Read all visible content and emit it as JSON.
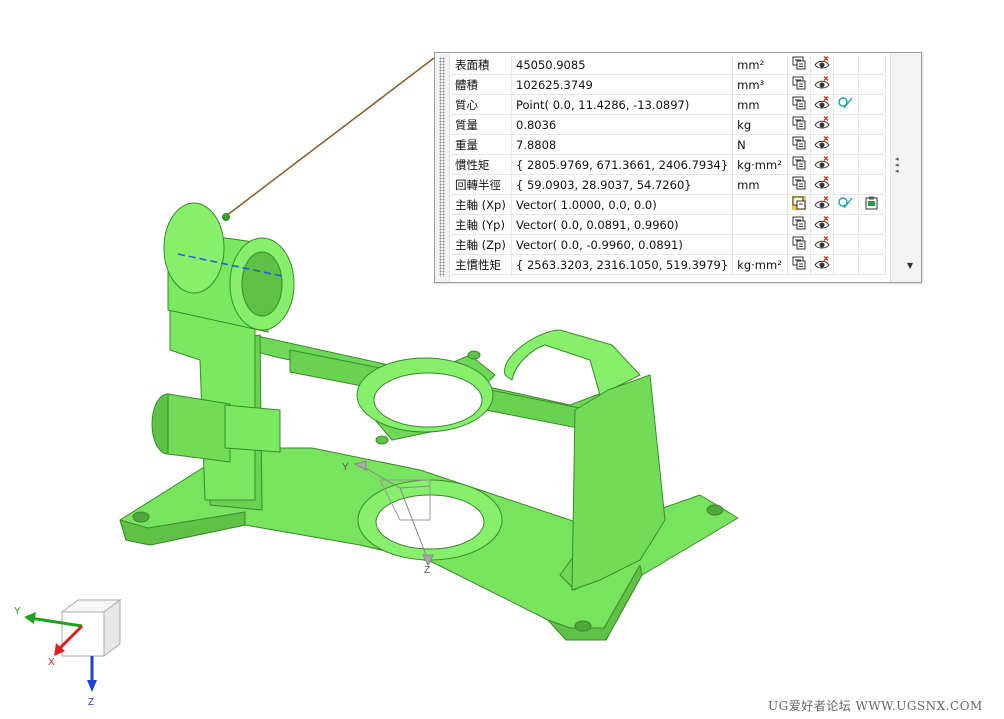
{
  "properties": [
    {
      "name": "表面積",
      "value": "45050.9085",
      "unit": "mm²",
      "extra": false,
      "special": false
    },
    {
      "name": "體積",
      "value": "102625.3749",
      "unit": "mm³",
      "extra": false,
      "special": false
    },
    {
      "name": "質心",
      "value": "Point( 0.0, 11.4286, -13.0897)",
      "unit": "mm",
      "extra": true,
      "special": false
    },
    {
      "name": "質量",
      "value": "0.8036",
      "unit": "kg",
      "extra": false,
      "special": false
    },
    {
      "name": "重量",
      "value": "7.8808",
      "unit": "N",
      "extra": false,
      "special": false
    },
    {
      "name": "慣性矩",
      "value": "{ 2805.9769, 671.3661, 2406.7934}",
      "unit": "kg·mm²",
      "extra": false,
      "special": false
    },
    {
      "name": "回轉半徑",
      "value": "{ 59.0903, 28.9037, 54.7260}",
      "unit": "mm",
      "extra": false,
      "special": false
    },
    {
      "name": "主軸 (Xp)",
      "value": "Vector( 1.0000, 0.0, 0.0)",
      "unit": "",
      "extra": true,
      "special": true
    },
    {
      "name": "主軸 (Yp)",
      "value": "Vector( 0.0, 0.0891, 0.9960)",
      "unit": "",
      "extra": false,
      "special": false
    },
    {
      "name": "主軸 (Zp)",
      "value": "Vector( 0.0, -0.9960, 0.0891)",
      "unit": "",
      "extra": false,
      "special": false
    },
    {
      "name": "主慣性矩",
      "value": "{ 2563.3203, 2316.1050, 519.3979}",
      "unit": "kg·mm²",
      "extra": false,
      "special": false
    }
  ],
  "axes": {
    "x": "X",
    "y": "Y",
    "z": "Z"
  },
  "csys": {
    "y": "Y",
    "z": "Z"
  },
  "icons": {
    "export": "expression-export-icon",
    "visibility": "eye-visibility-icon",
    "measure": "measure-link-icon",
    "clipboard": "copy-clipboard-icon"
  },
  "colors": {
    "part_fill": "#78e35f",
    "part_edge": "#3a8a2a",
    "leader_line": "#8b5a2b",
    "axis_x": "#e02020",
    "axis_y": "#20a020",
    "axis_z": "#2040d0"
  },
  "watermark": "UG爱好者论坛  WWW.UGSNX.COM"
}
